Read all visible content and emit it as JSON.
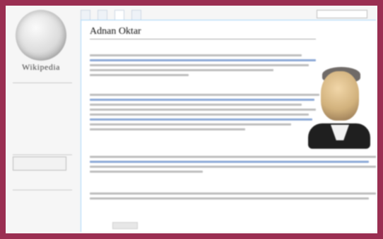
{
  "app": {
    "brand": "Wikipedia"
  },
  "tabs": [
    "",
    "",
    "",
    ""
  ],
  "sidebar": {
    "nav_heading": "",
    "nav_links": [
      "",
      "",
      "",
      "",
      "",
      "",
      "",
      ""
    ],
    "section2_heading": "",
    "section2_box": "",
    "section3_heading": "",
    "section3_links": [
      "",
      "",
      ""
    ]
  },
  "article": {
    "title": "Adnan Oktar",
    "subtitle": ""
  },
  "footer": {
    "chip": ""
  },
  "colors": {
    "frame": "#9a2f52",
    "link": "#2a5aa8"
  }
}
